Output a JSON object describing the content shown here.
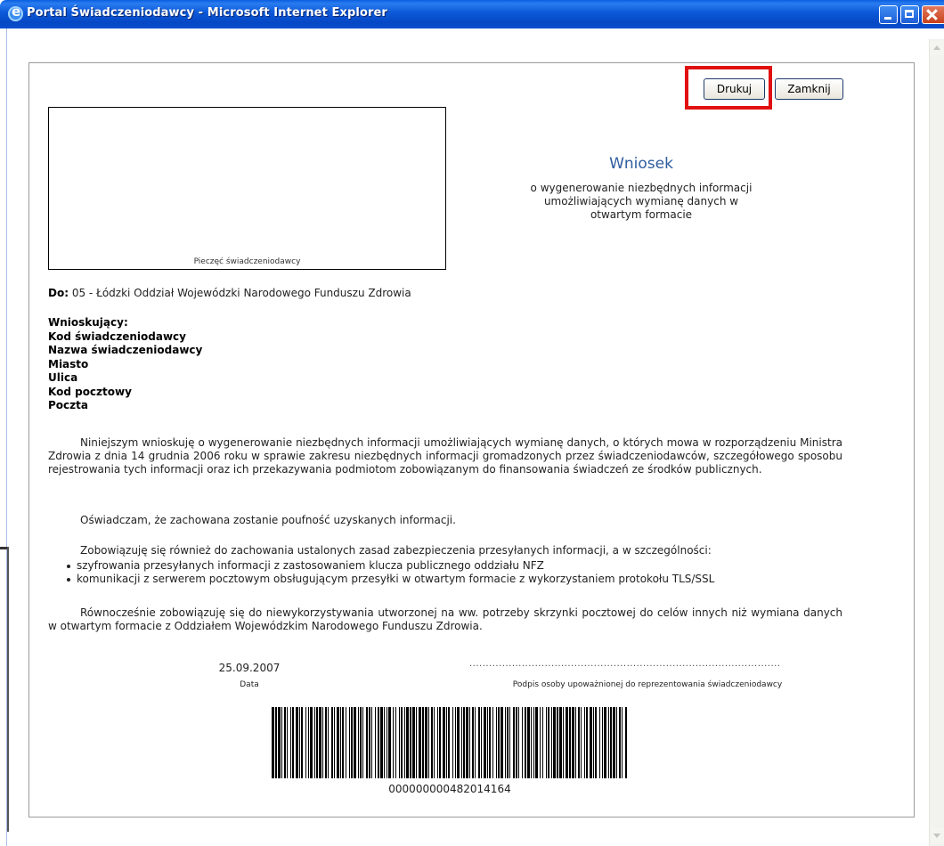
{
  "window": {
    "title": "Portal Świadczeniodawcy - Microsoft Internet Explorer"
  },
  "toolbar": {
    "print_label": "Drukuj",
    "close_label": "Zamknij"
  },
  "stamp": {
    "label": "Pieczęć świadczeniodawcy"
  },
  "header": {
    "title": "Wniosek",
    "subtitle": "o wygenerowanie niezbędnych informacji umożliwiających wymianę danych w otwartym formacie"
  },
  "recipient": {
    "label": "Do:",
    "value": "05 - Łódzki Oddział Wojewódzki Narodowego Funduszu Zdrowia"
  },
  "applicant": {
    "heading": "Wnioskujący:",
    "fields": [
      "Kod świadczeniodawcy",
      "Nazwa świadczeniodawcy",
      "Miasto",
      "Ulica",
      "Kod pocztowy",
      "Poczta"
    ]
  },
  "body": {
    "paragraph1": "Niniejszym wnioskuję o wygenerowanie niezbędnych informacji umożliwiających wymianę danych, o których mowa w rozporządzeniu Ministra Zdrowia z dnia 14 grudnia 2006 roku w sprawie zakresu niezbędnych informacji gromadzonych przez świadczeniodawców, szczegółowego sposobu rejestrowania tych informacji oraz ich przekazywania podmiotom zobowiązanym do finansowania świadczeń ze środków publicznych.",
    "paragraph2": "Oświadczam, że zachowana zostanie poufność uzyskanych informacji.",
    "paragraph3": "Zobowiązuję się również do zachowania ustalonych zasad zabezpieczenia przesyłanych informacji, a w szczególności:",
    "bullets": [
      "szyfrowania przesyłanych informacji z zastosowaniem klucza publicznego oddziału NFZ",
      "komunikacji z serwerem pocztowym obsługującym przesyłki w otwartym formacie z wykorzystaniem protokołu TLS/SSL"
    ],
    "paragraph4": "Równocześnie zobowiązuję się do niewykorzystywania utworzonej na ww. potrzeby skrzynki pocztowej do celów innych niż wymiana danych w otwartym formacie z Oddziałem Wojewódzkim Narodowego Funduszu Zdrowia."
  },
  "signature": {
    "date_value": "25.09.2007",
    "date_label": "Data",
    "dots": "...............................................................................................",
    "signer_label": "Podpis osoby upoważnionej do reprezentowania świadczeniodawcy"
  },
  "barcode": {
    "number": "000000000482014164"
  },
  "colors": {
    "title_bar": "#0b58d8",
    "heading_blue": "#2e5d9e",
    "highlight_red": "#e01010"
  }
}
